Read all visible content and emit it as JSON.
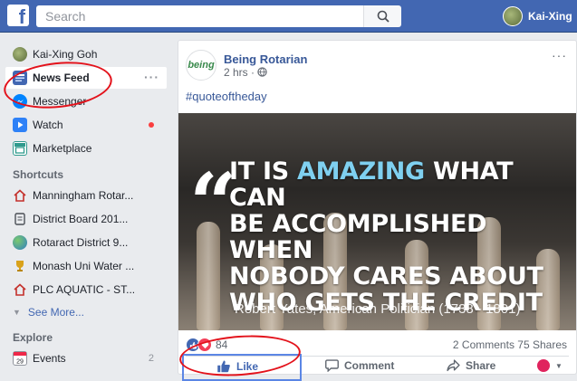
{
  "topbar": {
    "logo": "f",
    "search_placeholder": "Search",
    "profile_name": "Kai-Xing"
  },
  "sidebar": {
    "profile": "Kai-Xing Goh",
    "main": [
      {
        "label": "News Feed",
        "icon": "news-feed-icon",
        "active": true
      },
      {
        "label": "Messenger",
        "icon": "messenger-icon"
      },
      {
        "label": "Watch",
        "icon": "watch-icon"
      },
      {
        "label": "Marketplace",
        "icon": "marketplace-icon"
      }
    ],
    "shortcuts_heading": "Shortcuts",
    "shortcuts": [
      {
        "label": "Manningham Rotar...",
        "icon": "home-icon"
      },
      {
        "label": "District Board 201...",
        "icon": "document-icon"
      },
      {
        "label": "Rotaract District 9...",
        "icon": "globe-icon"
      },
      {
        "label": "Monash Uni Water ...",
        "icon": "trophy-icon"
      },
      {
        "label": "PLC AQUATIC - ST...",
        "icon": "home-icon"
      }
    ],
    "see_more": "See More...",
    "explore_heading": "Explore",
    "explore": [
      {
        "label": "Events",
        "icon": "calendar-icon",
        "count": "2"
      }
    ]
  },
  "post": {
    "page_name": "Being Rotarian",
    "page_logo_text": "being",
    "time": "2 hrs ·",
    "hashtag": "#quoteoftheday",
    "quote_line1": "IT IS",
    "quote_highlight": "AMAZING",
    "quote_line1_rest": "WHAT CAN",
    "quote_line2": "BE ACCOMPLISHED WHEN",
    "quote_line3": "NOBODY CARES ABOUT",
    "quote_line4": "WHO GETS THE CREDIT",
    "attribution": "Robert Yates, American Politician (1738 - 1801)",
    "reaction_count": "84",
    "comments": "2 Comments",
    "shares": "75 Shares",
    "like_label": "Like",
    "comment_label": "Comment",
    "share_label": "Share"
  },
  "colors": {
    "brand": "#4267b2",
    "annotation": "#e3121b",
    "highlight": "#7fd0f0"
  }
}
